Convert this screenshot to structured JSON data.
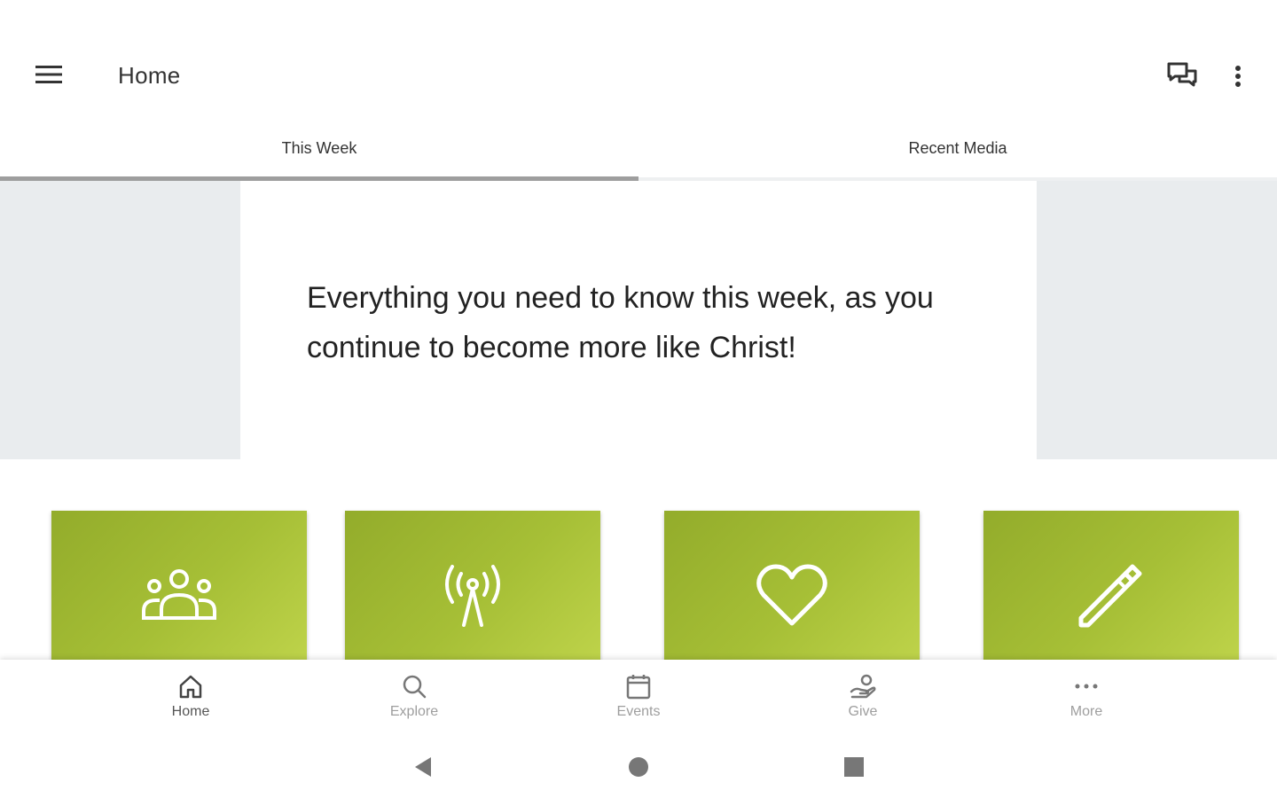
{
  "appbar": {
    "title": "Home",
    "menu_icon": "hamburger-menu-icon",
    "chat_icon": "chat-bubbles-icon",
    "more_icon": "kebab-menu-icon"
  },
  "tabs": [
    {
      "label": "This Week",
      "active": true
    },
    {
      "label": "Recent Media",
      "active": false
    }
  ],
  "hero": {
    "text": "Everything you need to know this week, as you continue to become more like Christ!"
  },
  "tiles": [
    {
      "icon": "people-group-icon"
    },
    {
      "icon": "broadcast-antenna-icon"
    },
    {
      "icon": "heart-icon"
    },
    {
      "icon": "pencil-icon"
    }
  ],
  "bottom_nav": [
    {
      "label": "Home",
      "icon": "home-icon",
      "active": true
    },
    {
      "label": "Explore",
      "icon": "search-icon",
      "active": false
    },
    {
      "label": "Events",
      "icon": "calendar-icon",
      "active": false
    },
    {
      "label": "Give",
      "icon": "give-hand-icon",
      "active": false
    },
    {
      "label": "More",
      "icon": "more-dots-icon",
      "active": false
    }
  ],
  "system_nav": {
    "back_icon": "back-triangle-icon",
    "home_icon": "home-circle-icon",
    "recents_icon": "recents-square-icon"
  },
  "colors": {
    "tile_gradient_start": "#93ac2b",
    "tile_gradient_end": "#bed34a",
    "hero_background": "#e9ecee",
    "tab_indicator": "#9e9e9e"
  }
}
